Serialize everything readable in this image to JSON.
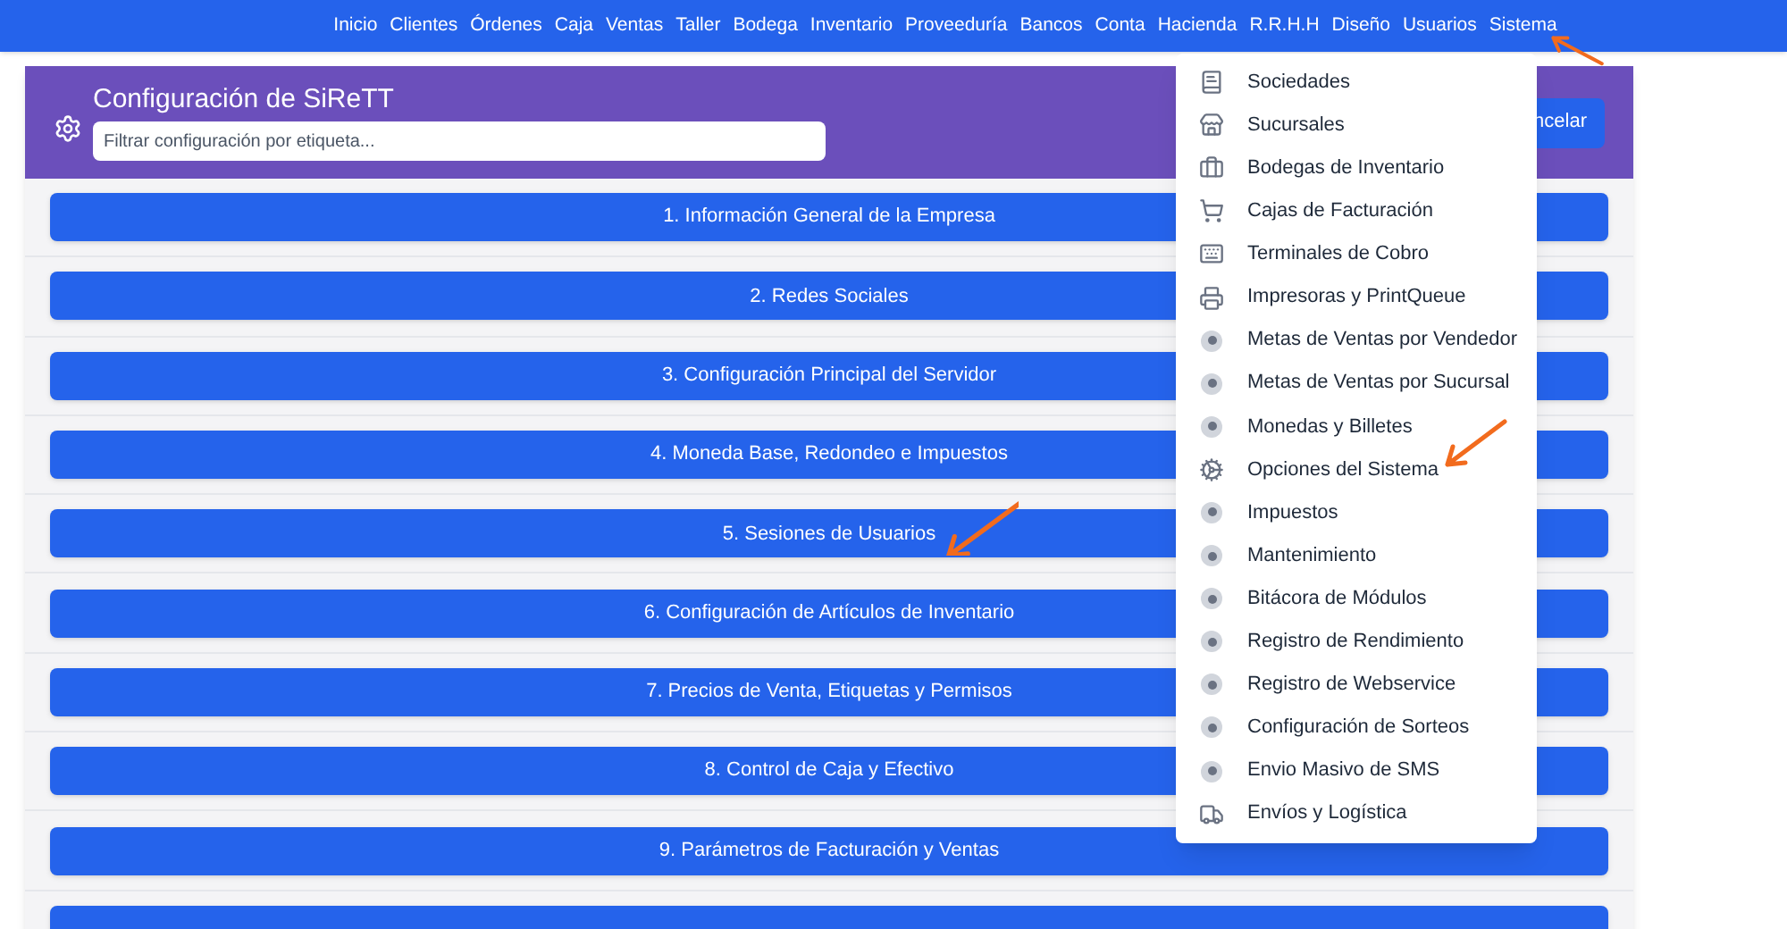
{
  "nav": {
    "items": [
      "Inicio",
      "Clientes",
      "Órdenes",
      "Caja",
      "Ventas",
      "Taller",
      "Bodega",
      "Inventario",
      "Proveeduría",
      "Bancos",
      "Conta",
      "Hacienda",
      "R.R.H.H",
      "Diseño",
      "Usuarios",
      "Sistema"
    ]
  },
  "panel": {
    "title": "Configuración de SiReTT",
    "filter": {
      "placeholder": "Filtrar configuración por etiqueta..."
    },
    "cancel_button": "ncelar",
    "sections": [
      "1. Información General de la Empresa",
      "2. Redes Sociales",
      "3. Configuración Principal del Servidor",
      "4. Moneda Base, Redondeo e Impuestos",
      "5. Sesiones de Usuarios",
      "6. Configuración de Artículos de Inventario",
      "7. Precios de Venta, Etiquetas y Permisos",
      "8. Control de Caja y Efectivo",
      "9. Parámetros de Facturación y Ventas"
    ]
  },
  "menu": {
    "items": [
      {
        "label": "Sociedades",
        "kind": "book"
      },
      {
        "label": "Sucursales",
        "kind": "store"
      },
      {
        "label": "Bodegas de Inventario",
        "kind": "briefcase"
      },
      {
        "label": "Cajas de Facturación",
        "kind": "cart"
      },
      {
        "label": "Terminales de Cobro",
        "kind": "keyboard"
      },
      {
        "label": "Impresoras y PrintQueue",
        "kind": "printer"
      },
      {
        "label": "Metas de Ventas por Vendedor",
        "kind": "dot"
      },
      {
        "label": "Metas de Ventas por Sucursal",
        "kind": "dot"
      },
      {
        "label": "Monedas y Billetes",
        "kind": "dot"
      },
      {
        "label": "Opciones del Sistema",
        "kind": "cogs"
      },
      {
        "label": "Impuestos",
        "kind": "dot"
      },
      {
        "label": "Mantenimiento",
        "kind": "dot"
      },
      {
        "label": "Bitácora de Módulos",
        "kind": "dot"
      },
      {
        "label": "Registro de Rendimiento",
        "kind": "dot"
      },
      {
        "label": "Registro de Webservice",
        "kind": "dot"
      },
      {
        "label": "Configuración de Sorteos",
        "kind": "dot"
      },
      {
        "label": "Envio Masivo de SMS",
        "kind": "dot"
      },
      {
        "label": "Envíos y Logística",
        "kind": "truck"
      }
    ]
  }
}
